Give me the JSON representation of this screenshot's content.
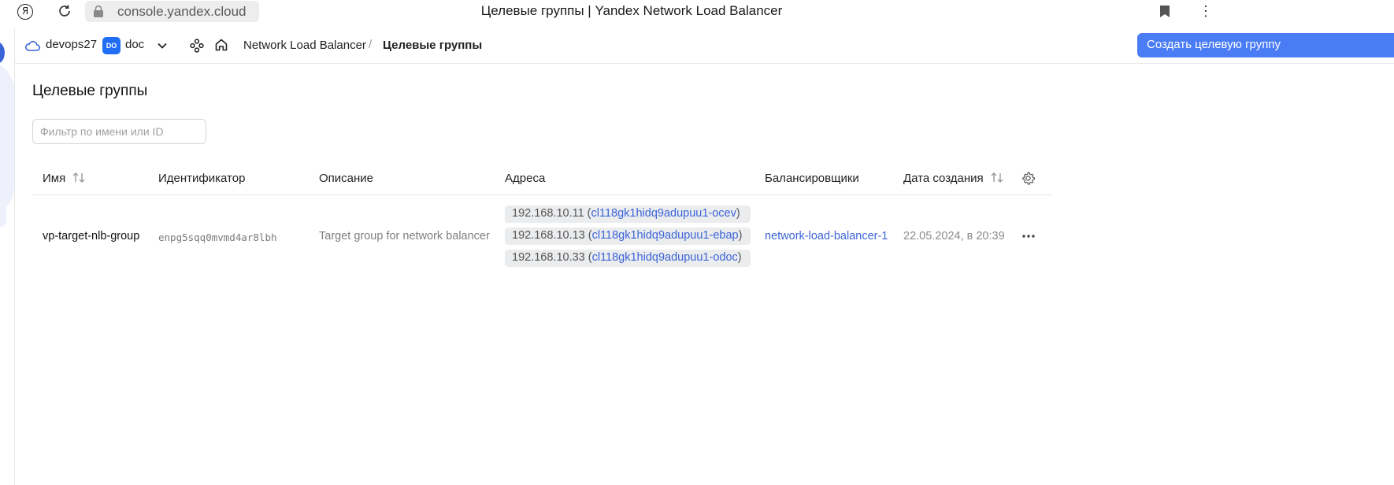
{
  "browser": {
    "url": "console.yandex.cloud",
    "page_title": "Целевые группы | Yandex Network Load Balancer"
  },
  "header": {
    "cloud_name": "devops27",
    "folder_badge": "DO",
    "folder_name": "doc",
    "breadcrumbs": [
      "Network Load Balancer",
      "Целевые группы"
    ],
    "breadcrumb_separator": "/",
    "create_button": "Создать целевую группу"
  },
  "main": {
    "title": "Целевые группы",
    "filter_placeholder": "Фильтр по имени или ID",
    "columns": {
      "name": "Имя",
      "id": "Идентификатор",
      "description": "Описание",
      "addresses": "Адреса",
      "balancers": "Балансировщики",
      "created": "Дата создания"
    },
    "rows": [
      {
        "name": "vp-target-nlb-group",
        "id": "enpg5sqq0mvmd4ar8lbh",
        "description": "Target group for network balancer",
        "addresses": [
          {
            "ip": "192.168.10.11",
            "instance": "cl118gk1hidq9adupuu1-ocev"
          },
          {
            "ip": "192.168.10.13",
            "instance": "cl118gk1hidq9adupuu1-ebap"
          },
          {
            "ip": "192.168.10.33",
            "instance": "cl118gk1hidq9adupuu1-odoc"
          }
        ],
        "balancer": "network-load-balancer-1",
        "created": "22.05.2024, в 20:39"
      }
    ]
  },
  "colors": {
    "accent": "#4a7cf5",
    "link": "#3b64d9",
    "chip_bg": "#ebecee"
  }
}
